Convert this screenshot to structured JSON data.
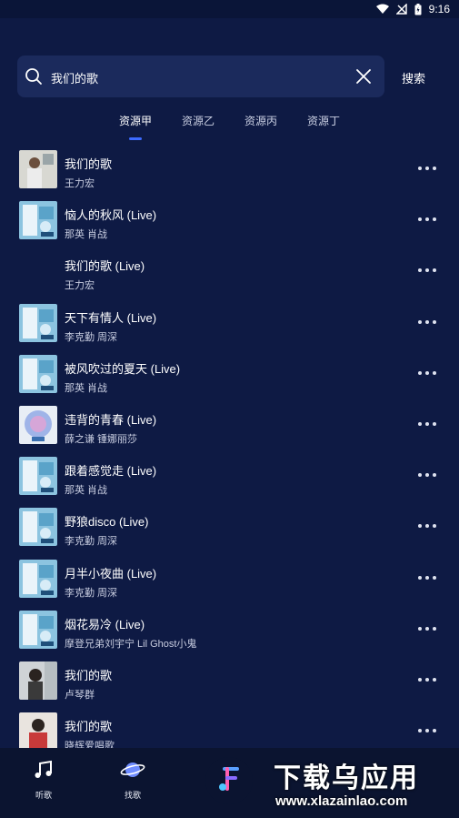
{
  "status_bar": {
    "time": "9:16"
  },
  "search": {
    "query": "我们的歌",
    "button_label": "搜索"
  },
  "tabs": [
    {
      "label": "资源甲",
      "active": true
    },
    {
      "label": "资源乙",
      "active": false
    },
    {
      "label": "资源丙",
      "active": false
    },
    {
      "label": "资源丁",
      "active": false
    }
  ],
  "songs": [
    {
      "title": "我们的歌",
      "artist": "王力宏",
      "cover": "photo-male"
    },
    {
      "title": "恼人的秋风 (Live)",
      "artist": "那英  肖战",
      "cover": "show-poster"
    },
    {
      "title": "我们的歌 (Live)",
      "artist": "王力宏",
      "cover": "none"
    },
    {
      "title": "天下有情人 (Live)",
      "artist": "李克勤  周深",
      "cover": "show-poster"
    },
    {
      "title": "被风吹过的夏天 (Live)",
      "artist": "那英  肖战",
      "cover": "show-poster"
    },
    {
      "title": "违背的青春 (Live)",
      "artist": "薛之谦  锺娜丽莎",
      "cover": "circle-art"
    },
    {
      "title": "跟着感觉走 (Live)",
      "artist": "那英  肖战",
      "cover": "show-poster"
    },
    {
      "title": "野狼disco (Live)",
      "artist": "李克勤  周深",
      "cover": "show-poster"
    },
    {
      "title": "月半小夜曲 (Live)",
      "artist": "李克勤  周深",
      "cover": "show-poster"
    },
    {
      "title": "烟花易冷 (Live)",
      "artist": "摩登兄弟刘宇宁  Lil Ghost小鬼",
      "cover": "show-poster"
    },
    {
      "title": "我们的歌",
      "artist": "卢琴群",
      "cover": "photo-female"
    },
    {
      "title": "我们的歌",
      "artist": "晓辉爱唱歌",
      "cover": "photo-male2"
    }
  ],
  "bottom_nav": [
    {
      "label": "听歌",
      "icon": "music-note-icon"
    },
    {
      "label": "找歌",
      "icon": "planet-icon"
    },
    {
      "label": "",
      "icon": "app-logo-icon"
    }
  ],
  "watermark": {
    "line1": "下载乌应用",
    "line2": "www.xlazainlao.com"
  },
  "colors": {
    "background": "#0e1a44",
    "search_box": "#1b2a5c",
    "accent": "#3d6bff"
  }
}
